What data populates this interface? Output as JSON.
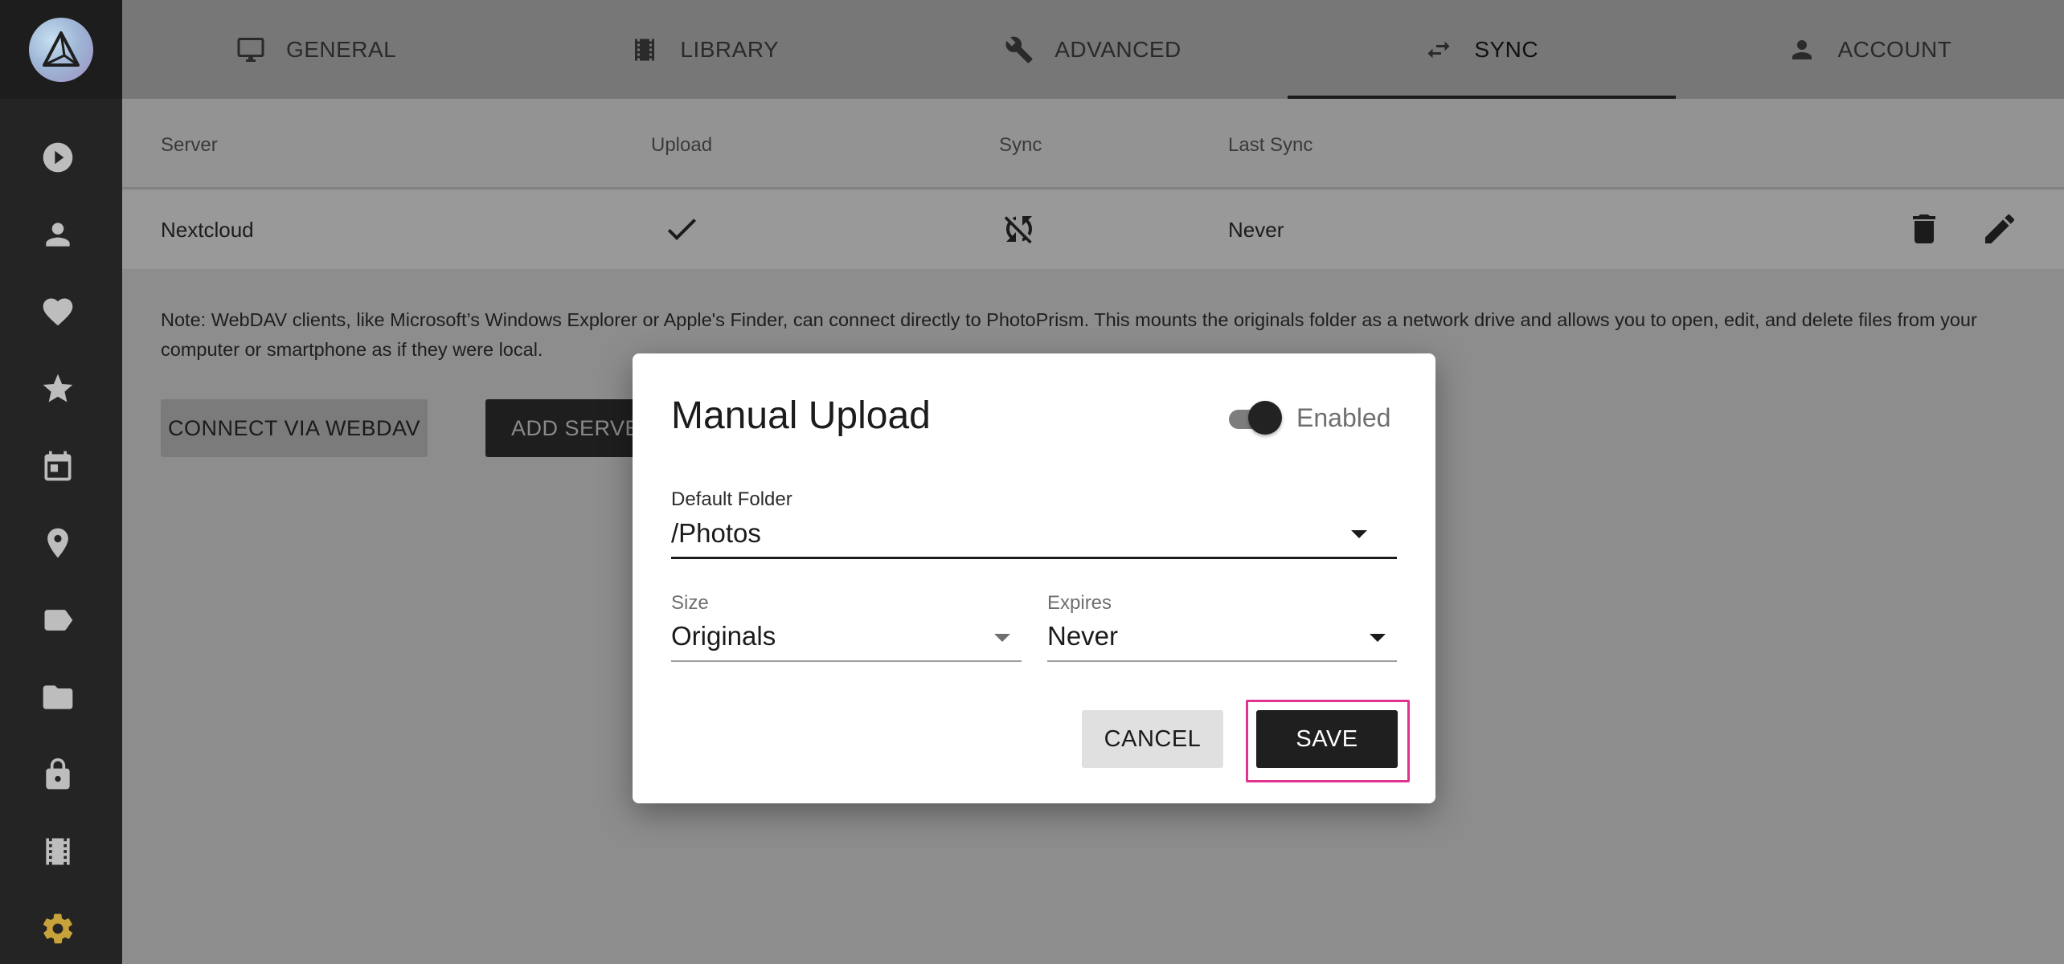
{
  "tabs": [
    {
      "label": "GENERAL",
      "icon": "monitor-icon"
    },
    {
      "label": "LIBRARY",
      "icon": "film-icon"
    },
    {
      "label": "ADVANCED",
      "icon": "wrench-icon"
    },
    {
      "label": "SYNC",
      "icon": "swap-icon",
      "active": true
    },
    {
      "label": "ACCOUNT",
      "icon": "person-icon"
    }
  ],
  "sidebar": {
    "items": [
      "play-icon",
      "person-icon",
      "heart-icon",
      "star-icon",
      "calendar-icon",
      "location-icon",
      "label-icon",
      "folder-icon",
      "lock-icon",
      "film-icon",
      "gear-icon"
    ],
    "active_color": "#c7a23a"
  },
  "table": {
    "headers": {
      "server": "Server",
      "upload": "Upload",
      "sync": "Sync",
      "last_sync": "Last Sync"
    },
    "rows": [
      {
        "server": "Nextcloud",
        "upload": "check-icon",
        "sync": "sync-disabled-icon",
        "last_sync": "Never"
      }
    ]
  },
  "note": "Note: WebDAV clients, like Microsoft’s Windows Explorer or Apple's Finder, can connect directly to PhotoPrism. This mounts the originals folder as a network drive and allows you to open, edit, and delete files from your computer or smartphone as if they were local.",
  "buttons": {
    "connect_webdav": "CONNECT VIA WEBDAV",
    "add_server": "ADD SERVE"
  },
  "dialog": {
    "title": "Manual Upload",
    "toggle_label": "Enabled",
    "default_folder": {
      "label": "Default Folder",
      "value": "/Photos"
    },
    "size": {
      "label": "Size",
      "value": "Originals"
    },
    "expires": {
      "label": "Expires",
      "value": "Never"
    },
    "cancel_label": "CANCEL",
    "save_label": "SAVE",
    "highlight_color": "#e0338f"
  }
}
